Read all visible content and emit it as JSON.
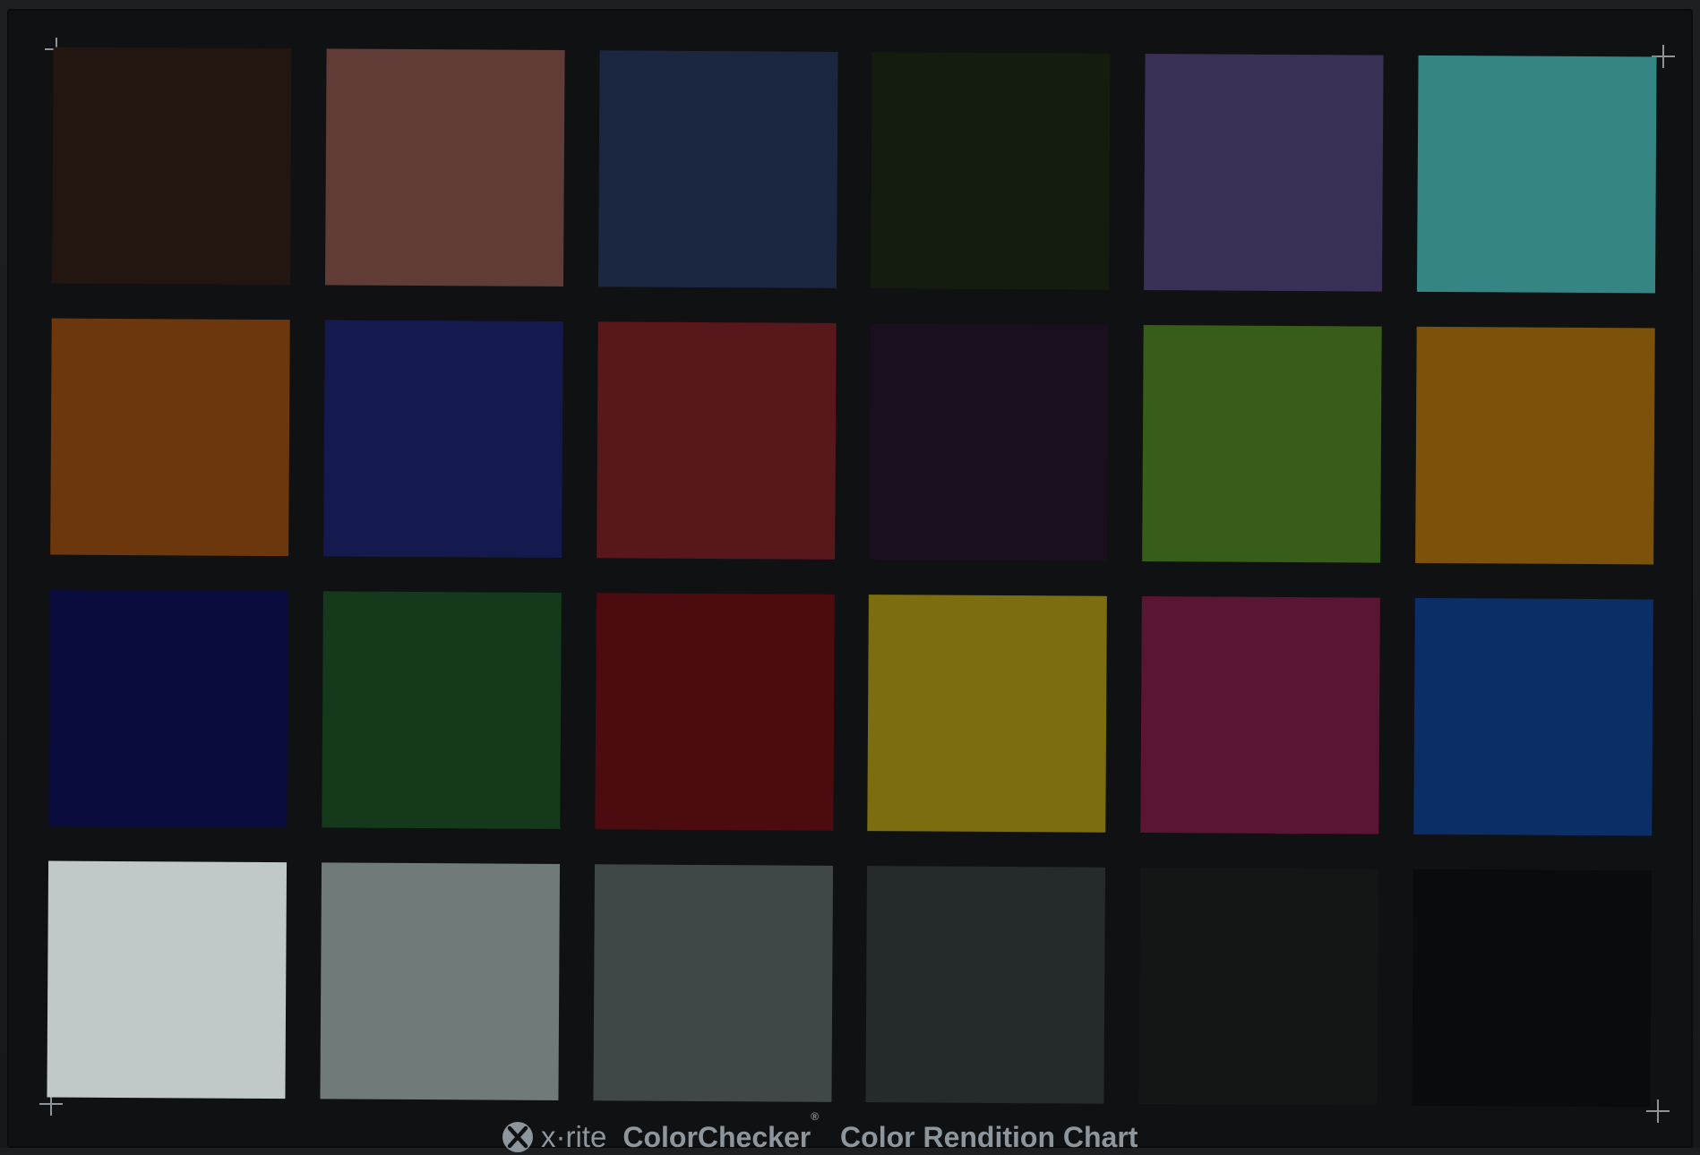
{
  "brand": {
    "logo_text": "x·rite",
    "product_name": "ColorChecker",
    "trademark": "®",
    "chart_name": "Color Rendition Chart",
    "text_color": "#8d969c"
  },
  "card": {
    "background": "#0f1112"
  },
  "patches": [
    {
      "color": "#23150f"
    },
    {
      "color": "#613b36"
    },
    {
      "color": "#1b2741"
    },
    {
      "color": "#141c0d"
    },
    {
      "color": "#3a2f55"
    },
    {
      "color": "#358585"
    },
    {
      "color": "#6c370c"
    },
    {
      "color": "#141a4d"
    },
    {
      "color": "#57171b"
    },
    {
      "color": "#190f1e"
    },
    {
      "color": "#385d18"
    },
    {
      "color": "#7c520b"
    },
    {
      "color": "#0b0c3e"
    },
    {
      "color": "#14391b"
    },
    {
      "color": "#4c0c0f"
    },
    {
      "color": "#7c6e0e"
    },
    {
      "color": "#5a1535"
    },
    {
      "color": "#0c2e66"
    },
    {
      "color": "#c0c8c8"
    },
    {
      "color": "#707a7b"
    },
    {
      "color": "#3f4747"
    },
    {
      "color": "#252a2a"
    },
    {
      "color": "#141616"
    },
    {
      "color": "#0a0b0c"
    }
  ]
}
